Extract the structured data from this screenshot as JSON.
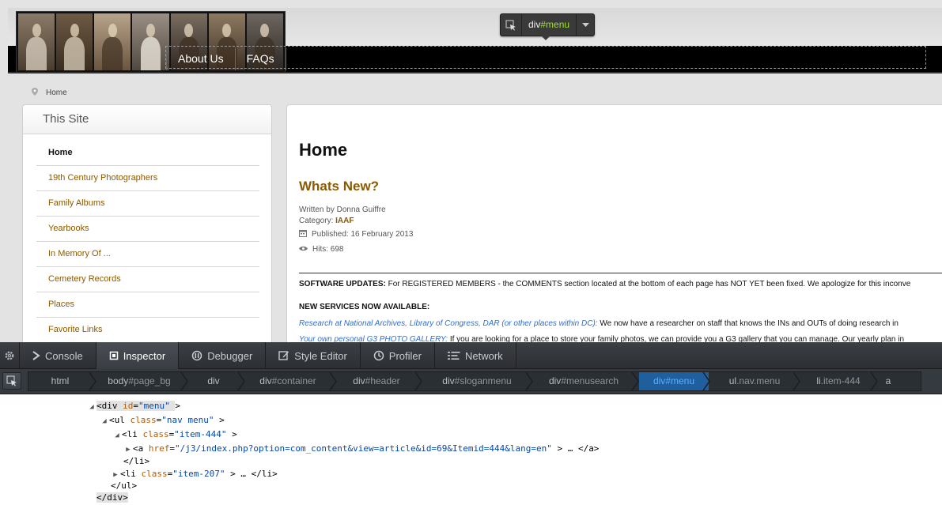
{
  "site": {
    "nav": [
      "About Us",
      "FAQs"
    ],
    "highlighter": {
      "tag": "div",
      "id": "#menu"
    },
    "breadcrumb": "Home",
    "sidebar": {
      "title": "This Site",
      "items": [
        "Home",
        "19th Century Photographers",
        "Family Albums",
        "Yearbooks",
        "In Memory Of ...",
        "Cemetery Records",
        "Places",
        "Favorite Links"
      ]
    },
    "article": {
      "page_heading": "Home",
      "title": "Whats New?",
      "written_by": "Written by Donna Guiffre",
      "category_label": "Category: ",
      "category_value": "IAAF",
      "published": "Published: 16 February 2013",
      "hits": "Hits: 698",
      "software_label": "SOFTWARE UPDATES:",
      "software_text": " For REGISTERED MEMBERS - the COMMENTS section located at the bottom of each page has NOT YET been fixed.  We apologize for this inconve",
      "new_services": "NEW SERVICES NOW AVAILABLE:",
      "research_link": "Research at National Archives, Library of Congress, DAR (or other places within DC):",
      "research_text": "  We now have a researcher on staff that knows the INs and OUTs of doing research in",
      "gallery_link": "Your own personal G3 PHOTO GALLERY:",
      "gallery_text": " If you are looking for a place to store your family photos, we can provide you a G3 gallery that you can manage. Our yearly plan in"
    }
  },
  "devtools": {
    "tabs": [
      "Console",
      "Inspector",
      "Debugger",
      "Style Editor",
      "Profiler",
      "Network"
    ],
    "active_tab": "Inspector",
    "breadcrumbs": [
      {
        "tag": "html",
        "id": ""
      },
      {
        "tag": "body",
        "id": "#page_bg"
      },
      {
        "tag": "div",
        "id": ""
      },
      {
        "tag": "div",
        "id": "#container"
      },
      {
        "tag": "div",
        "id": "#header"
      },
      {
        "tag": "div",
        "id": "#sloganmenu"
      },
      {
        "tag": "div",
        "id": "#menusearch"
      },
      {
        "tag": "div",
        "id": "#menu"
      },
      {
        "tag": "ul",
        "id": ".nav.menu"
      },
      {
        "tag": "li",
        "id": ".item-444"
      },
      {
        "tag": "a",
        "id": ""
      }
    ],
    "markup": {
      "l1_tag": "<div ",
      "l1_attr": "id",
      "l1_val": "\"menu\"",
      "l1_end": ">",
      "l2_tag": "<ul ",
      "l2_attr": "class",
      "l2_val": "\"nav menu\"",
      "l2_end": ">",
      "l3_tag": "<li ",
      "l3_attr": "class",
      "l3_val": "\"item-444\"",
      "l3_end": ">",
      "l4_tag": "<a ",
      "l4_attr": "href",
      "l4_val": "\"/j3/index.php?option=com_content&view=article&id=69&Itemid=444&lang=en\"",
      "l4_end": "> … </a>",
      "l5": "</li>",
      "l6_tag": "<li ",
      "l6_attr": "class",
      "l6_val": "\"item-207\"",
      "l6_end": "> … </li>",
      "l7": "</ul>",
      "l8": "</div>"
    }
  }
}
